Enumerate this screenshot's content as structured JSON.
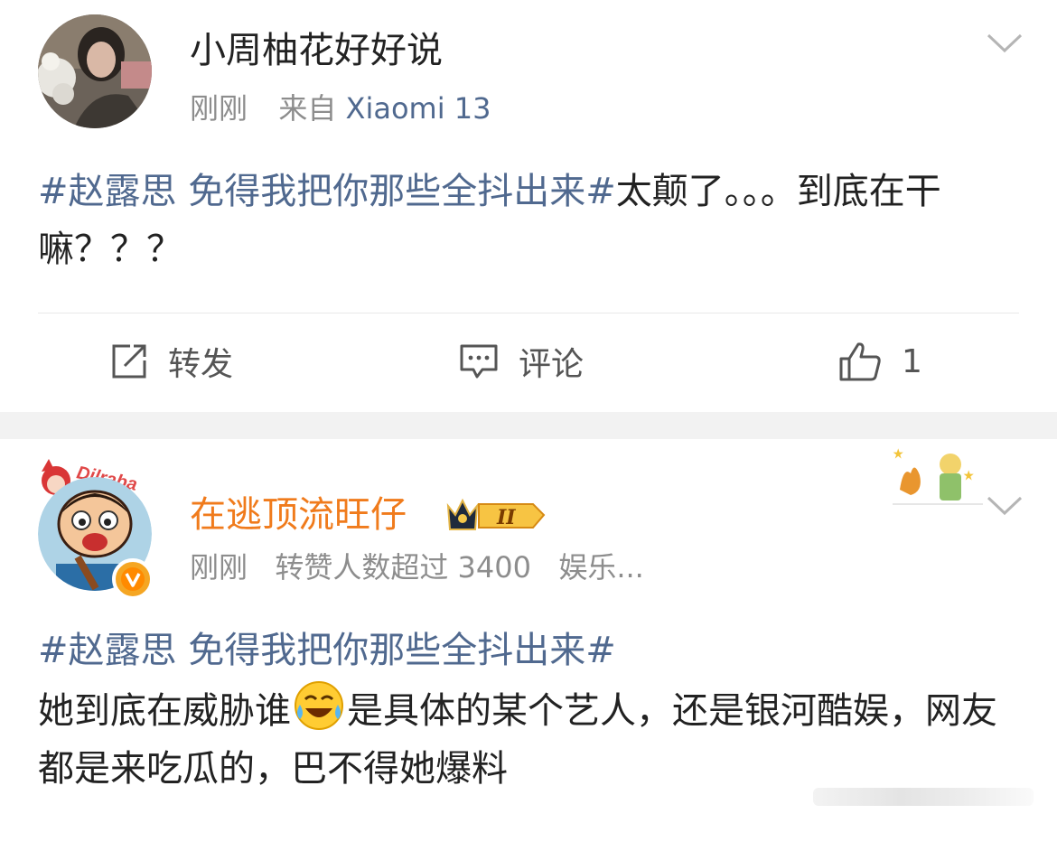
{
  "posts": [
    {
      "username": "小周柚花好好说",
      "time": "刚刚",
      "source_prefix": "来自",
      "source": "Xiaomi 13",
      "hashtag": "#赵露思 免得我把你那些全抖出来#",
      "text": "太颠了。。。到底在干嘛？？？",
      "actions": {
        "repost": "转发",
        "comment": "评论",
        "like_count": "1"
      }
    },
    {
      "username": "在逃顶流旺仔",
      "badge": "II",
      "time": "刚刚",
      "meta_extra": "转赞人数超过 3400",
      "category": "娱乐...",
      "hashtag": "#赵露思 免得我把你那些全抖出来#",
      "text_before_emoji": "她到底在威胁谁",
      "emoji": "laugh-cry-emoji",
      "text_after_emoji": "是具体的某个艺人，还是银河酷娱，网友都是来吃瓜的，巴不得她爆料"
    }
  ],
  "colors": {
    "link": "#50698f",
    "vip_name": "#f07b1c",
    "meta": "#8d8d8d",
    "separator": "#f2f2f2"
  }
}
